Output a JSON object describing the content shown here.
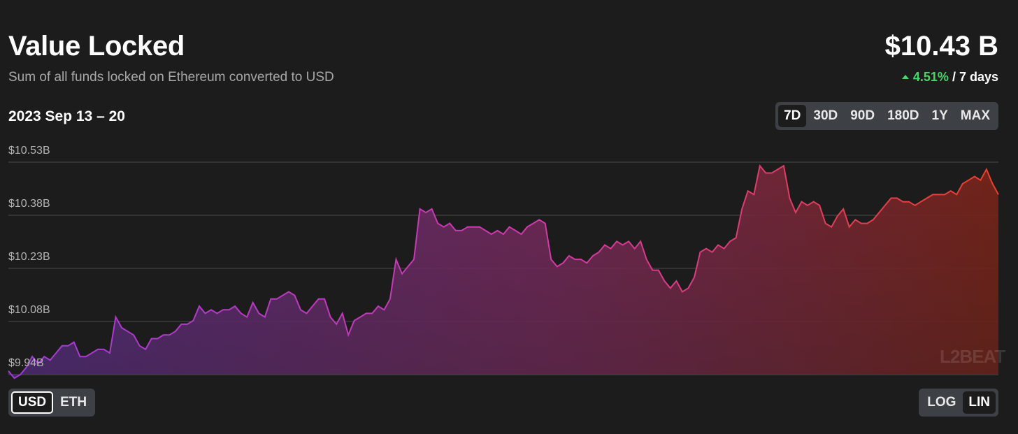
{
  "header": {
    "title": "Value Locked",
    "subtitle": "Sum of all funds locked on Ethereum converted to USD",
    "total": "$10.43 B",
    "change_pct": "4.51%",
    "change_period": "/ 7 days",
    "date_range": "2023 Sep 13 – 20"
  },
  "timeframes": [
    "7D",
    "30D",
    "90D",
    "180D",
    "1Y",
    "MAX"
  ],
  "timeframe_selected": "7D",
  "currency_toggle": {
    "options": [
      "USD",
      "ETH"
    ],
    "selected": "USD"
  },
  "scale_toggle": {
    "options": [
      "LOG",
      "LIN"
    ],
    "selected": "LIN"
  },
  "watermark": "L2BEAT",
  "colors": {
    "gradient_start": "#a23bd6",
    "gradient_mid": "#d23aa8",
    "gradient_end": "#e8412a",
    "accent_up": "#4bd46a"
  },
  "chart_data": {
    "type": "area",
    "yticks": [
      "$10.53B",
      "$10.38B",
      "$10.23B",
      "$10.08B",
      "$9.94B"
    ],
    "ylim": [
      9.94,
      10.53
    ],
    "grid": true,
    "x_range": "2023 Sep 13 – 20",
    "series": [
      {
        "values": [
          9.95,
          9.93,
          9.94,
          9.96,
          9.99,
          9.97,
          9.99,
          9.98,
          10.0,
          10.02,
          10.02,
          10.03,
          9.99,
          9.99,
          10.0,
          10.01,
          10.01,
          10.0,
          10.1,
          10.07,
          10.06,
          10.05,
          10.02,
          10.01,
          10.04,
          10.04,
          10.05,
          10.05,
          10.06,
          10.08,
          10.08,
          10.09,
          10.13,
          10.11,
          10.12,
          10.11,
          10.12,
          10.12,
          10.13,
          10.11,
          10.1,
          10.14,
          10.11,
          10.1,
          10.15,
          10.15,
          10.16,
          10.17,
          10.16,
          10.12,
          10.11,
          10.13,
          10.15,
          10.15,
          10.1,
          10.08,
          10.11,
          10.05,
          10.09,
          10.1,
          10.11,
          10.11,
          10.13,
          10.12,
          10.15,
          10.26,
          10.22,
          10.24,
          10.26,
          10.4,
          10.39,
          10.4,
          10.36,
          10.35,
          10.36,
          10.34,
          10.34,
          10.35,
          10.35,
          10.35,
          10.34,
          10.33,
          10.34,
          10.33,
          10.35,
          10.34,
          10.33,
          10.35,
          10.36,
          10.37,
          10.36,
          10.26,
          10.24,
          10.25,
          10.27,
          10.26,
          10.26,
          10.25,
          10.27,
          10.28,
          10.3,
          10.29,
          10.31,
          10.3,
          10.31,
          10.29,
          10.31,
          10.26,
          10.23,
          10.23,
          10.2,
          10.18,
          10.2,
          10.17,
          10.18,
          10.21,
          10.28,
          10.29,
          10.28,
          10.3,
          10.29,
          10.31,
          10.32,
          10.4,
          10.45,
          10.44,
          10.52,
          10.5,
          10.5,
          10.51,
          10.52,
          10.43,
          10.39,
          10.42,
          10.41,
          10.42,
          10.41,
          10.36,
          10.35,
          10.38,
          10.4,
          10.35,
          10.37,
          10.36,
          10.36,
          10.37,
          10.39,
          10.41,
          10.43,
          10.43,
          10.42,
          10.42,
          10.41,
          10.42,
          10.43,
          10.44,
          10.44,
          10.44,
          10.45,
          10.44,
          10.47,
          10.48,
          10.49,
          10.48,
          10.51,
          10.47,
          10.44
        ]
      }
    ]
  }
}
